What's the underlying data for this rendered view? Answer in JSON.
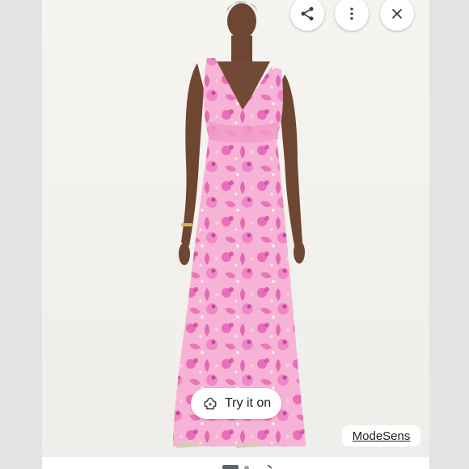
{
  "viewer": {
    "image_alt": "Pink floral print maxi dress",
    "actions": {
      "share_icon": "share-icon",
      "more_icon": "more-vertical-icon",
      "close_icon": "close-icon"
    },
    "try_on": {
      "label": "Try it on",
      "icon": "try-on-sparkle-icon"
    },
    "source": {
      "label": "ModeSens"
    }
  },
  "colors": {
    "dress_base": "#f6a9cf",
    "dress_print": "#e04fa8",
    "skin": "#6e4632",
    "background": "#f3f2ef"
  }
}
